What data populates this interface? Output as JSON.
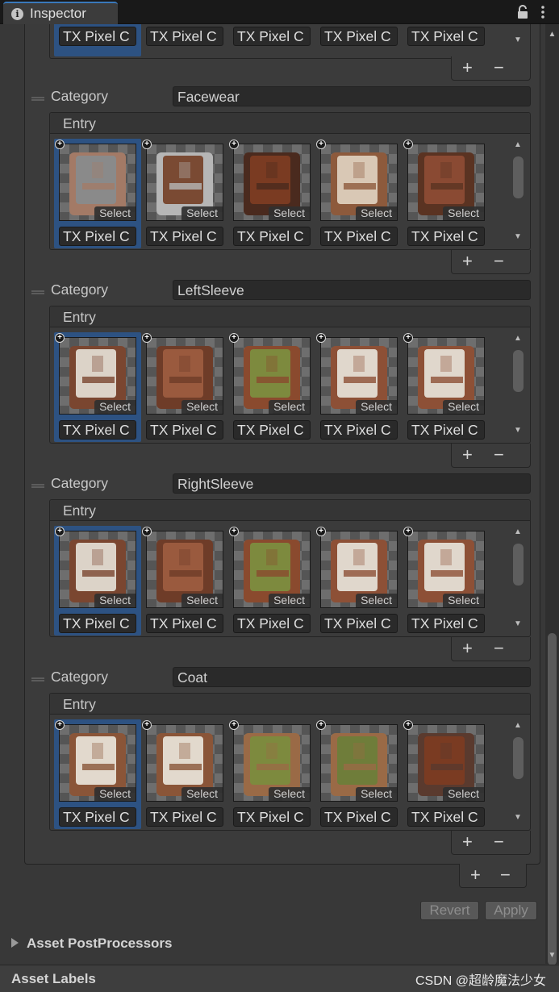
{
  "window": {
    "tab_title": "Inspector",
    "lock_icon": "lock-icon",
    "menu_icon": "kebab-menu-icon"
  },
  "top_partial": {
    "item_names": [
      "TX Pixel C",
      "TX Pixel C",
      "TX Pixel C",
      "TX Pixel C",
      "TX Pixel C"
    ],
    "plus": "+",
    "minus": "−"
  },
  "categories": [
    {
      "label": "Category",
      "value": "Facewear",
      "entry_label": "Entry",
      "select_label": "Select",
      "items": [
        "TX Pixel C",
        "TX Pixel C",
        "TX Pixel C",
        "TX Pixel C",
        "TX Pixel C"
      ],
      "plus": "+",
      "minus": "−"
    },
    {
      "label": "Category",
      "value": "LeftSleeve",
      "entry_label": "Entry",
      "select_label": "Select",
      "items": [
        "TX Pixel C",
        "TX Pixel C",
        "TX Pixel C",
        "TX Pixel C",
        "TX Pixel C"
      ],
      "plus": "+",
      "minus": "−"
    },
    {
      "label": "Category",
      "value": "RightSleeve",
      "entry_label": "Entry",
      "select_label": "Select",
      "items": [
        "TX Pixel C",
        "TX Pixel C",
        "TX Pixel C",
        "TX Pixel C",
        "TX Pixel C"
      ],
      "plus": "+",
      "minus": "−"
    },
    {
      "label": "Category",
      "value": "Coat",
      "entry_label": "Entry",
      "select_label": "Select",
      "items": [
        "TX Pixel C",
        "TX Pixel C",
        "TX Pixel C",
        "TX Pixel C",
        "TX Pixel C"
      ],
      "plus": "+",
      "minus": "−"
    }
  ],
  "outer_list": {
    "plus": "+",
    "minus": "−"
  },
  "buttons": {
    "revert": "Revert",
    "apply": "Apply"
  },
  "sections": {
    "post_processors": "Asset PostProcessors",
    "labels": "Asset Labels"
  },
  "watermark": "CSDN @超龄魔法少女",
  "colors": {
    "selection": "#2d5282",
    "tab_accent": "#3a79bb",
    "panel": "#383838"
  }
}
